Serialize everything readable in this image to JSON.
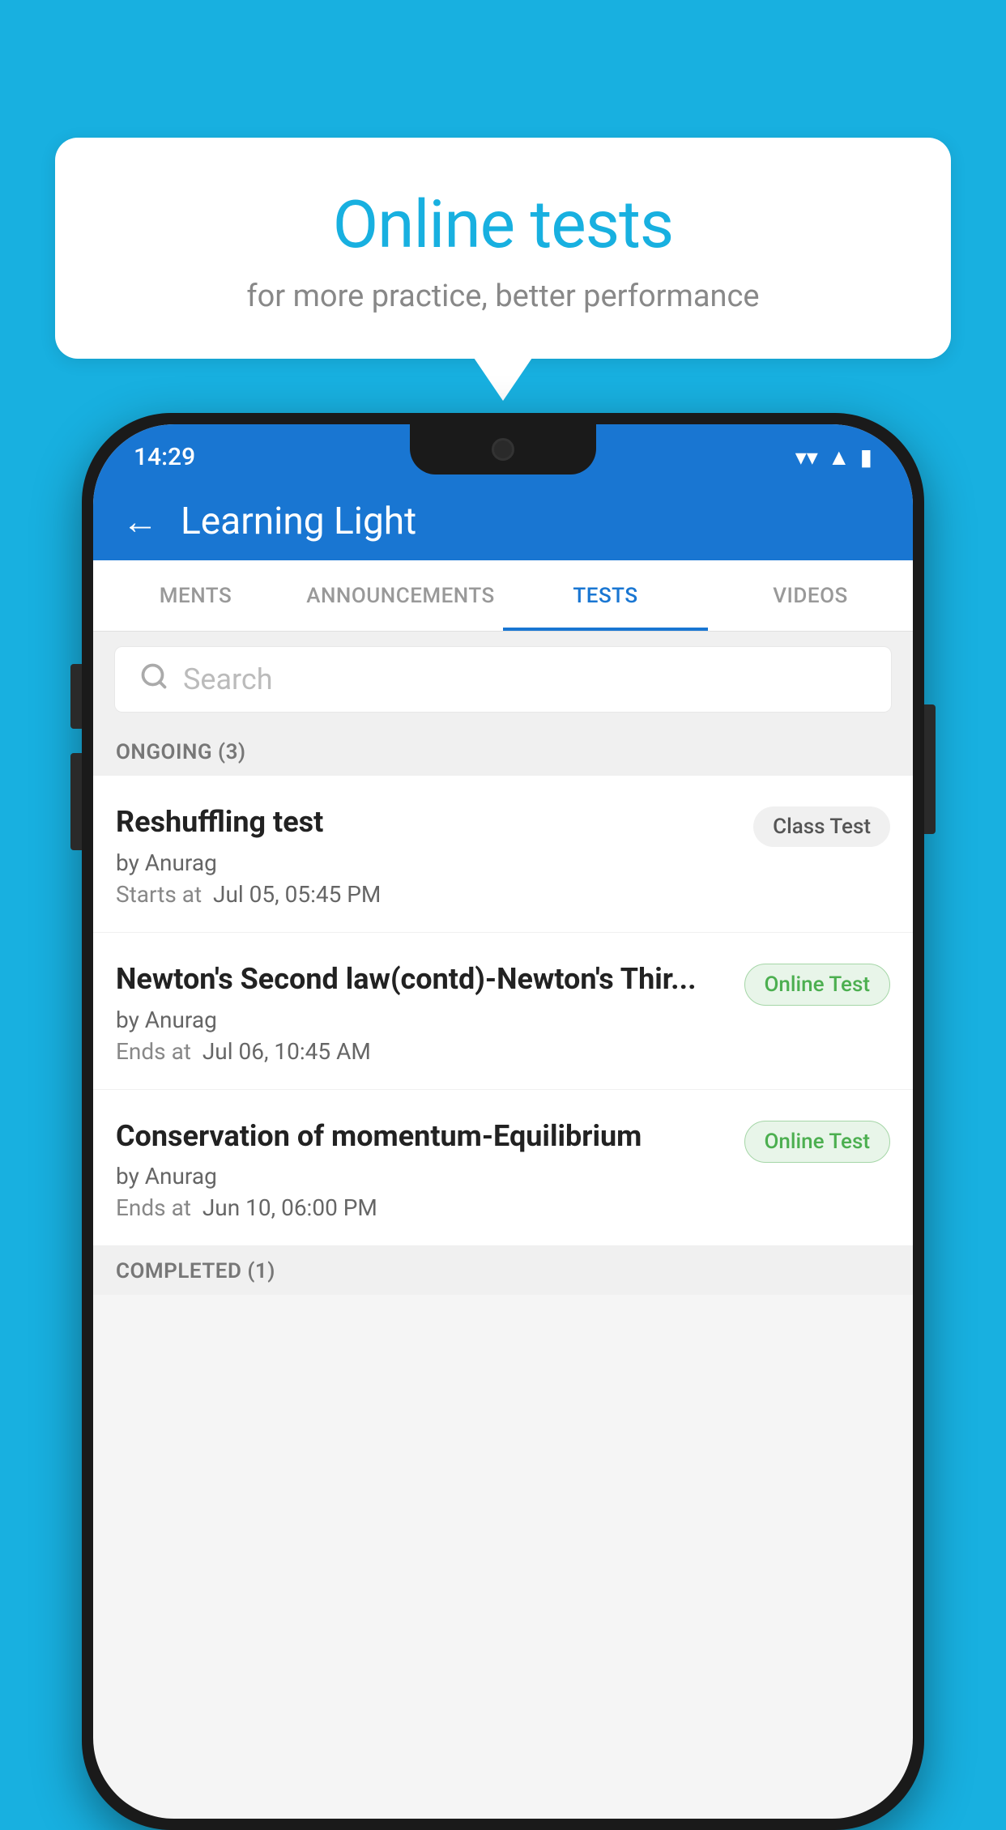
{
  "background": {
    "color": "#18b0e0"
  },
  "speech_bubble": {
    "title": "Online tests",
    "subtitle": "for more practice, better performance"
  },
  "phone": {
    "status_bar": {
      "time": "14:29",
      "wifi": "▼",
      "signal": "▲",
      "battery": "▮"
    },
    "header": {
      "back_label": "←",
      "title": "Learning Light"
    },
    "tabs": [
      {
        "label": "MENTS",
        "active": false
      },
      {
        "label": "ANNOUNCEMENTS",
        "active": false
      },
      {
        "label": "TESTS",
        "active": true
      },
      {
        "label": "VIDEOS",
        "active": false
      }
    ],
    "search": {
      "placeholder": "Search"
    },
    "ongoing_section": {
      "label": "ONGOING (3)"
    },
    "test_items": [
      {
        "name": "Reshuffling test",
        "author": "by Anurag",
        "time_label": "Starts at",
        "time_value": "Jul 05, 05:45 PM",
        "badge": "Class Test",
        "badge_type": "class"
      },
      {
        "name": "Newton's Second law(contd)-Newton's Thir...",
        "author": "by Anurag",
        "time_label": "Ends at",
        "time_value": "Jul 06, 10:45 AM",
        "badge": "Online Test",
        "badge_type": "online"
      },
      {
        "name": "Conservation of momentum-Equilibrium",
        "author": "by Anurag",
        "time_label": "Ends at",
        "time_value": "Jun 10, 06:00 PM",
        "badge": "Online Test",
        "badge_type": "online"
      }
    ],
    "completed_section": {
      "label": "COMPLETED (1)"
    }
  }
}
